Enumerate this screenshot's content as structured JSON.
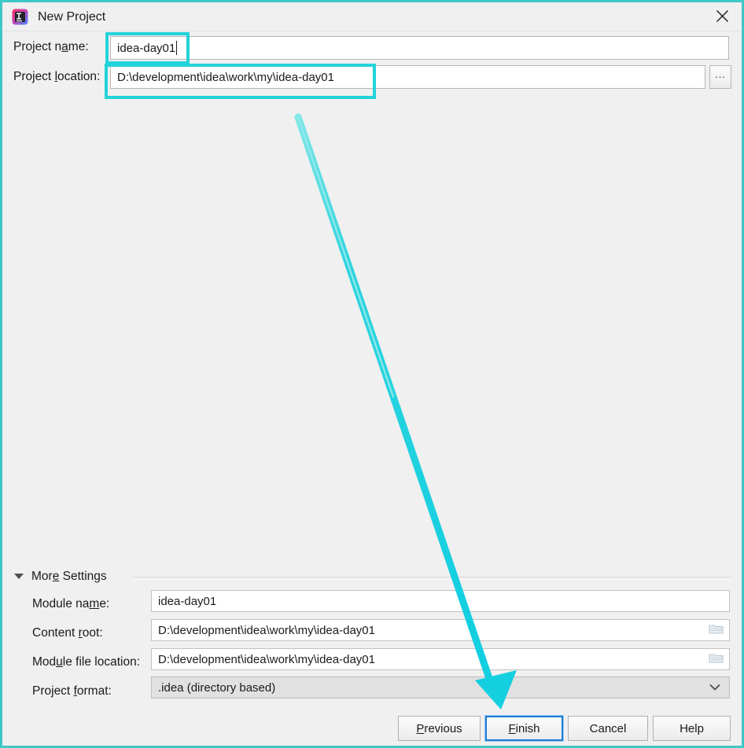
{
  "window": {
    "title": "New Project",
    "app_icon": "intellij-idea-icon",
    "close_icon": "close-icon",
    "highlight_color": "#3fc7c7"
  },
  "form": {
    "project_name": {
      "label_before": "Project n",
      "label_mnemonic": "a",
      "label_after": "me:",
      "value": "idea-day01",
      "placeholder": ""
    },
    "project_location": {
      "label_before": "Project ",
      "label_mnemonic": "l",
      "label_after": "ocation:",
      "value": "D:\\development\\idea\\work\\my\\idea-day01",
      "placeholder": "",
      "browse_label": "..."
    }
  },
  "more_settings": {
    "label_before": "Mor",
    "label_mnemonic": "e",
    "label_after": " Settings",
    "expanded": true,
    "toggle_icon": "triangle-down-icon",
    "rows": [
      {
        "label_before": "Module na",
        "label_mnemonic": "m",
        "label_after": "e:",
        "value": "idea-day01",
        "type": "text",
        "has_browse": false
      },
      {
        "label_before": "Content ",
        "label_mnemonic": "r",
        "label_after": "oot:",
        "value": "D:\\development\\idea\\work\\my\\idea-day01",
        "type": "text",
        "has_browse": true,
        "browse_icon": "folder-icon"
      },
      {
        "label_before": "Mod",
        "label_mnemonic": "u",
        "label_after": "le file location:",
        "value": "D:\\development\\idea\\work\\my\\idea-day01",
        "type": "text",
        "has_browse": true,
        "browse_icon": "folder-icon"
      },
      {
        "label_before": "Project ",
        "label_mnemonic": "f",
        "label_after": "ormat:",
        "value": ".idea (directory based)",
        "type": "combo",
        "dropdown_icon": "chevron-down-icon"
      }
    ]
  },
  "buttons": [
    {
      "before": "",
      "mnemonic": "P",
      "after": "revious",
      "focused": false
    },
    {
      "before": "",
      "mnemonic": "F",
      "after": "inish",
      "focused": true
    },
    {
      "before": "Cancel",
      "mnemonic": "",
      "after": "",
      "focused": false
    },
    {
      "before": "Help",
      "mnemonic": "",
      "after": "",
      "focused": false
    }
  ],
  "annotations": {
    "color": "#22d3d9",
    "rect_project_name": "highlight around project name input",
    "rect_project_location": "highlight around project location input",
    "arrow": "arrow pointing from upper area down to the Finish button"
  }
}
